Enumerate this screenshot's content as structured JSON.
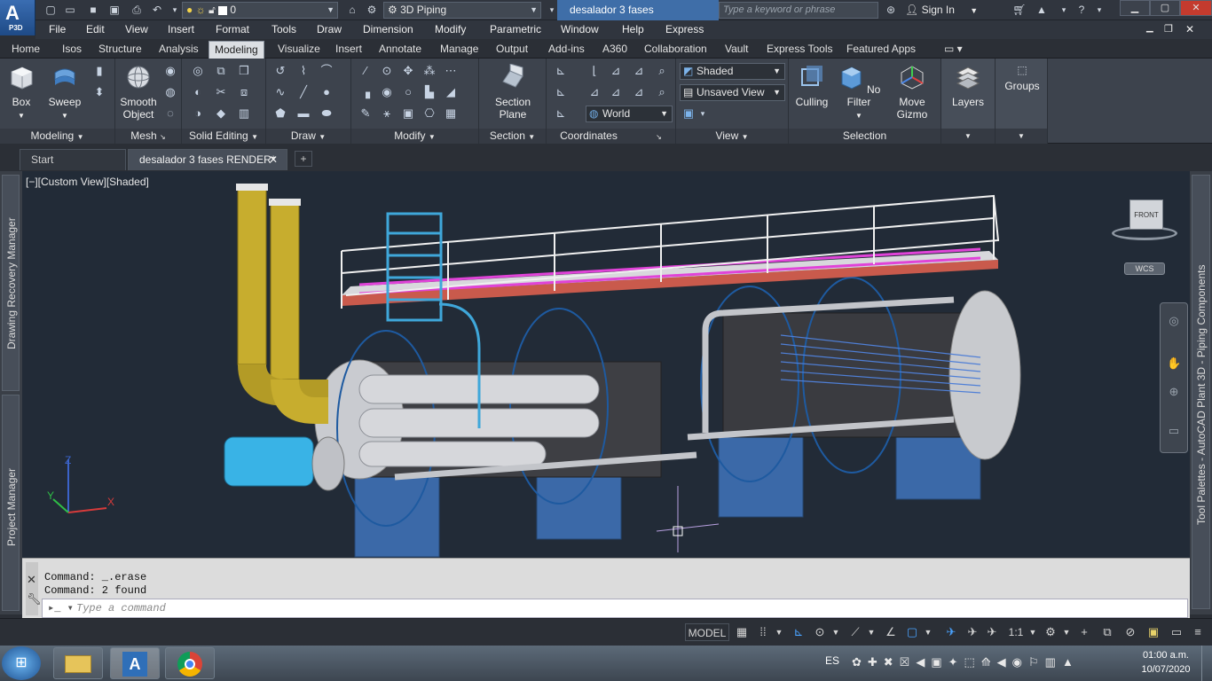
{
  "app": {
    "logo_letter": "A",
    "logo_sub": "P3D",
    "document_title": "desalador 3 fases RENDER.d..."
  },
  "quick_access": {
    "layer_value": "0",
    "workspace": "3D Piping"
  },
  "search": {
    "placeholder": "Type a keyword or phrase"
  },
  "account": {
    "sign_in": "Sign In"
  },
  "menu_items": [
    "File",
    "Edit",
    "View",
    "Insert",
    "Format",
    "Tools",
    "Draw",
    "Dimension",
    "Modify",
    "Parametric",
    "Window",
    "Help",
    "Express"
  ],
  "ribbon_tabs": [
    "Home",
    "Isos",
    "Structure",
    "Analysis",
    "Modeling",
    "Visualize",
    "Insert",
    "Annotate",
    "Manage",
    "Output",
    "Add-ins",
    "A360",
    "Collaboration",
    "Vault",
    "Express Tools",
    "Featured Apps"
  ],
  "ribbon_panels": {
    "modeling": {
      "title": "Modeling",
      "box": "Box",
      "sweep": "Sweep"
    },
    "mesh": {
      "title": "Mesh",
      "smooth_1": "Smooth",
      "smooth_2": "Object"
    },
    "solid_editing": {
      "title": "Solid Editing"
    },
    "draw": {
      "title": "Draw"
    },
    "modify": {
      "title": "Modify"
    },
    "section": {
      "title": "Section",
      "plane_1": "Section",
      "plane_2": "Plane"
    },
    "coordinates": {
      "title": "Coordinates",
      "ucs": "World"
    },
    "view": {
      "title": "View",
      "visual_style": "Shaded",
      "saved_view": "Unsaved View"
    },
    "selection": {
      "title": "Selection",
      "culling": "Culling",
      "filter": "No Filter",
      "gizmo_1": "Move",
      "gizmo_2": "Gizmo"
    },
    "layers": {
      "title": "Layers"
    },
    "groups": {
      "title": "Groups"
    }
  },
  "file_tabs": {
    "start": "Start",
    "document": "desalador 3 fases RENDER*"
  },
  "viewport": {
    "label": "[−][Custom View][Shaded]",
    "viewcube_face": "FRONT",
    "wcs": "WCS"
  },
  "palettes": {
    "left_top": "Drawing Recovery Manager",
    "left_bottom": "Project Manager",
    "right": "Tool Palettes - AutoCAD Plant 3D - Piping Components"
  },
  "command": {
    "line1": "Command: _.erase",
    "line2": "Command: 2 found",
    "placeholder": "Type a command"
  },
  "status": {
    "model": "MODEL",
    "scale": "1:1"
  },
  "taskbar": {
    "lang": "ES",
    "time": "01:00 a.m.",
    "date": "10/07/2020"
  },
  "colors": {
    "accent": "#3f6ea8",
    "viewport_bg": "#222b37",
    "ribbon_bg": "#3d434d"
  }
}
